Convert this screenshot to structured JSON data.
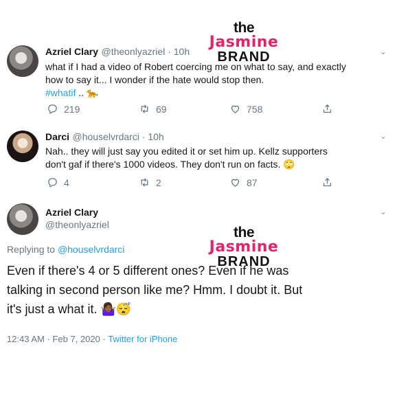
{
  "watermark": {
    "line1": "the",
    "line2": "Jasmine",
    "line3": "BRAND"
  },
  "tweet1": {
    "name": "Azriel Clary",
    "handle_time": "@theonlyazriel · 10h",
    "text_line1": "what if I had a video of Robert coercing me on what to say, and exactly",
    "text_line2": "how to say it... I wonder if the hate would stop then.",
    "hashtag": "#whatif",
    "hashtag_suffix": " .. ",
    "emoji": "🐆",
    "replies": "219",
    "retweets": "69",
    "likes": "758"
  },
  "tweet2": {
    "name": "Darci",
    "handle_time": "@houselvrdarci · 10h",
    "text_line1": "Nah.. they will just say you edited it or set him up. Kellz supporters",
    "text_line2": "don't gaf if there's 1000 videos. They don't run on facts.",
    "emoji": "🙄",
    "replies": "4",
    "retweets": "2",
    "likes": "87"
  },
  "tweet3": {
    "name": "Azriel Clary",
    "handle": "@theonlyazriel",
    "replying_prefix": "Replying to ",
    "replying_handle": "@houselvrdarci",
    "line1": "Even if there's 4 or 5 different ones? Even if he was",
    "line2": "talking in second person like me? Hmm. I doubt it. But",
    "line3": "it's just a what it.",
    "emojis": "🤷🏾‍♀️😴",
    "timestamp": "12:43 AM · Feb 7, 2020",
    "source": "Twitter for iPhone"
  },
  "colors": {
    "accent": "#1da1f2",
    "brand_pink": "#e0256a",
    "secondary_text": "#657786"
  },
  "icons": [
    "reply-icon",
    "retweet-icon",
    "like-icon",
    "share-icon",
    "chevron-down-icon"
  ]
}
